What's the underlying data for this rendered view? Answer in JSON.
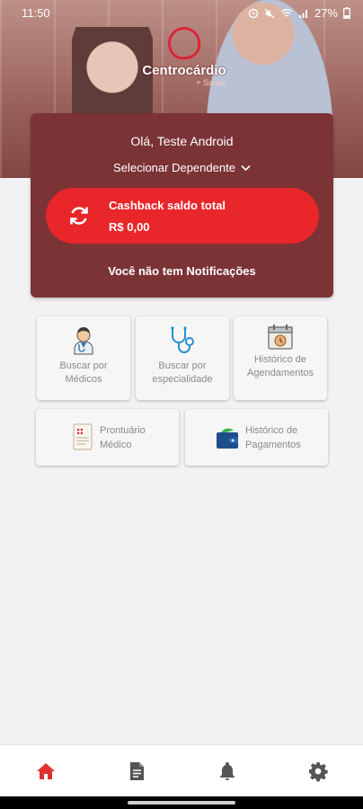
{
  "status_bar": {
    "time": "11:50",
    "battery": "27%"
  },
  "brand": {
    "name": "Centrocárdio",
    "tagline": "+ Saúde"
  },
  "user_card": {
    "greeting": "Olá, Teste Android",
    "dependent_selector": "Selecionar Dependente",
    "cashback_label": "Cashback saldo total",
    "cashback_value": "R$ 0,00",
    "notifications_text": "Você não tem Notificações"
  },
  "tiles": [
    {
      "label_line1": "Buscar por",
      "label_line2": "Médicos",
      "icon": "doctor-icon"
    },
    {
      "label_line1": "Buscar por",
      "label_line2": "especialidade",
      "icon": "stethoscope-icon"
    },
    {
      "label_line1": "Histórico de",
      "label_line2": "Agendamentos",
      "icon": "calendar-icon"
    },
    {
      "label_line1": "Prontuário",
      "label_line2": "Médico",
      "icon": "medical-record-icon"
    },
    {
      "label_line1": "Histórico de",
      "label_line2": "Pagamentos",
      "icon": "wallet-icon"
    }
  ],
  "bottom_nav": [
    {
      "icon": "home-icon",
      "active": true
    },
    {
      "icon": "document-icon",
      "active": false
    },
    {
      "icon": "bell-icon",
      "active": false
    },
    {
      "icon": "gear-icon",
      "active": false
    }
  ],
  "colors": {
    "card_bg": "#7c3336",
    "accent_red": "#e9262a",
    "active_nav": "#e0312f",
    "inactive_nav": "#555555"
  }
}
